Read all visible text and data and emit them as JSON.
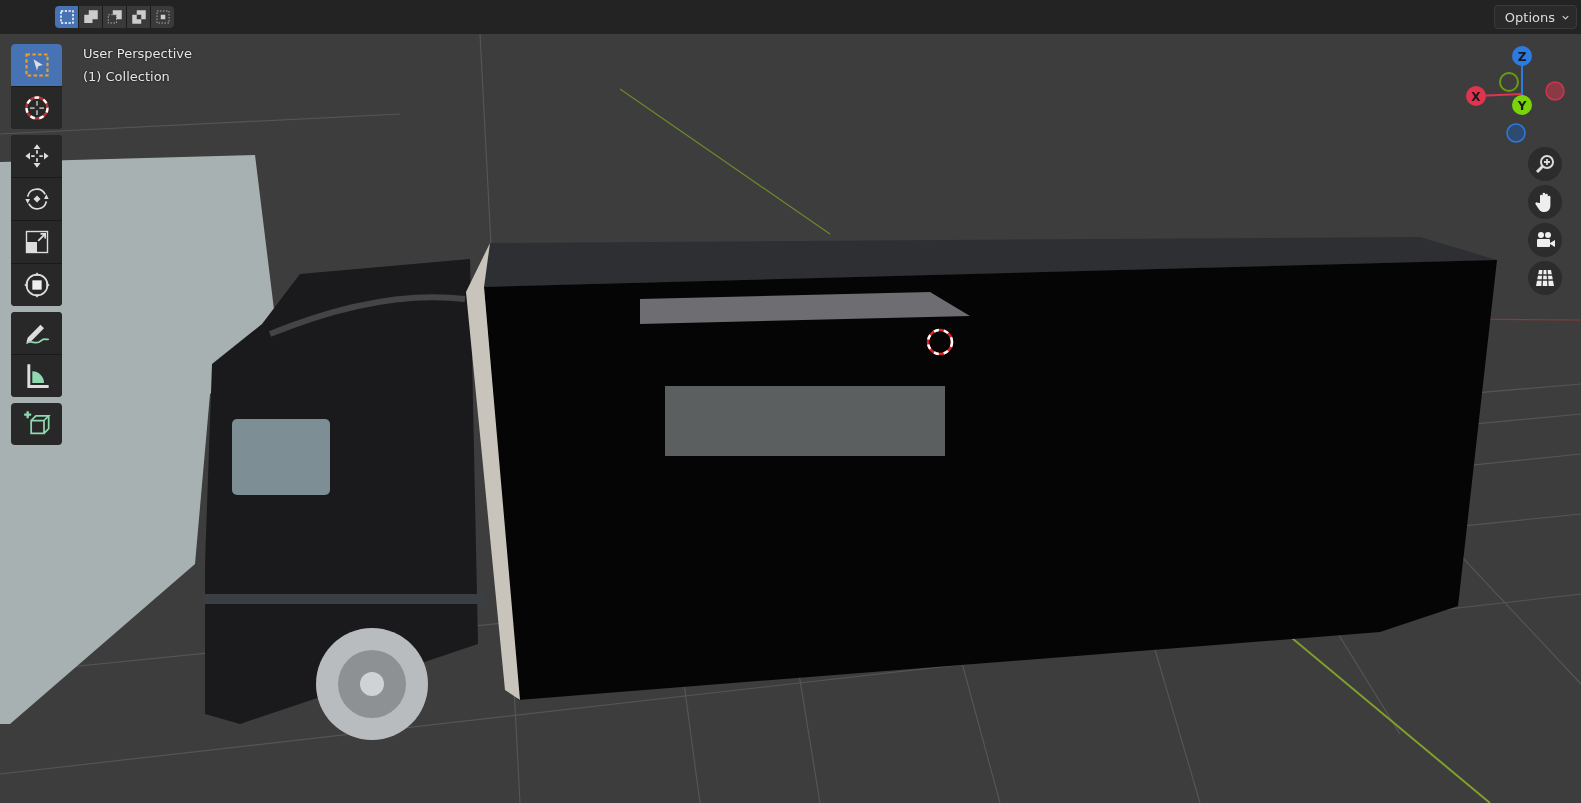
{
  "header": {
    "select_modes": [
      {
        "selected": true
      },
      {
        "selected": false
      },
      {
        "selected": false
      },
      {
        "selected": false
      },
      {
        "selected": false
      }
    ],
    "options": {
      "label": "Options"
    }
  },
  "viewport": {
    "view_name": "User Perspective",
    "collection": "(1) Collection"
  },
  "toolbar": {
    "groups": [
      [
        {
          "selected": true
        },
        {
          "selected": false
        }
      ],
      [
        {
          "selected": false
        },
        {
          "selected": false
        },
        {
          "selected": false
        },
        {
          "selected": false
        }
      ],
      [
        {
          "selected": false
        },
        {
          "selected": false
        }
      ],
      [
        {
          "selected": false
        }
      ]
    ]
  },
  "gizmo": {
    "axes": [
      {
        "label": "Z"
      },
      {
        "label": "X"
      },
      {
        "label": "Y"
      }
    ]
  }
}
